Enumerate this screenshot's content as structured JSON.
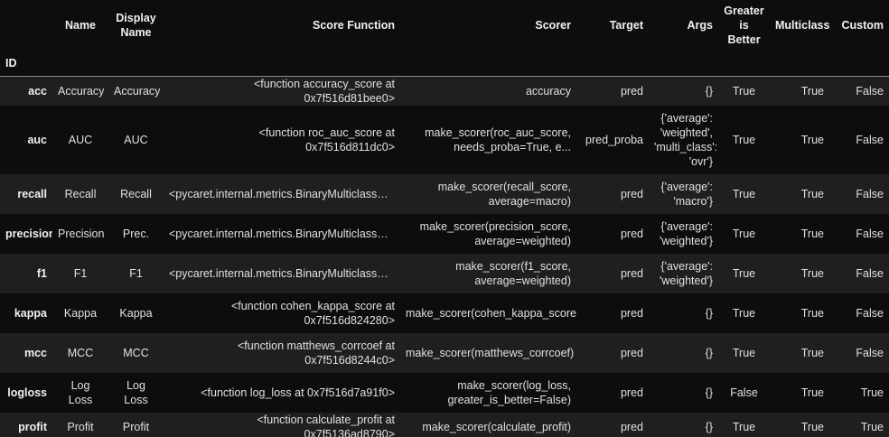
{
  "table": {
    "index_name": "ID",
    "columns": [
      "Name",
      "Display Name",
      "Score Function",
      "Scorer",
      "Target",
      "Args",
      "Greater is Better",
      "Multiclass",
      "Custom"
    ],
    "rows": [
      {
        "id": "acc",
        "cells": [
          "Accuracy",
          "Accuracy",
          "<function accuracy_score at 0x7f516d81bee0>",
          "accuracy",
          "pred",
          "{}",
          "True",
          "True",
          "False"
        ]
      },
      {
        "id": "auc",
        "cells": [
          "AUC",
          "AUC",
          "<function roc_auc_score at 0x7f516d811dc0>",
          "make_scorer(roc_auc_score, needs_proba=True, e...",
          "pred_proba",
          "{'average': 'weighted', 'multi_class': 'ovr'}",
          "True",
          "True",
          "False"
        ]
      },
      {
        "id": "recall",
        "cells": [
          "Recall",
          "Recall",
          "<pycaret.internal.metrics.BinaryMulticlassScor...",
          "make_scorer(recall_score, average=macro)",
          "pred",
          "{'average': 'macro'}",
          "True",
          "True",
          "False"
        ]
      },
      {
        "id": "precision",
        "cells": [
          "Precision",
          "Prec.",
          "<pycaret.internal.metrics.BinaryMulticlassScor...",
          "make_scorer(precision_score, average=weighted)",
          "pred",
          "{'average': 'weighted'}",
          "True",
          "True",
          "False"
        ]
      },
      {
        "id": "f1",
        "cells": [
          "F1",
          "F1",
          "<pycaret.internal.metrics.BinaryMulticlassScor...",
          "make_scorer(f1_score, average=weighted)",
          "pred",
          "{'average': 'weighted'}",
          "True",
          "True",
          "False"
        ]
      },
      {
        "id": "kappa",
        "cells": [
          "Kappa",
          "Kappa",
          "<function cohen_kappa_score at 0x7f516d824280>",
          "make_scorer(cohen_kappa_score)",
          "pred",
          "{}",
          "True",
          "True",
          "False"
        ]
      },
      {
        "id": "mcc",
        "cells": [
          "MCC",
          "MCC",
          "<function matthews_corrcoef at 0x7f516d8244c0>",
          "make_scorer(matthews_corrcoef)",
          "pred",
          "{}",
          "True",
          "True",
          "False"
        ]
      },
      {
        "id": "logloss",
        "cells": [
          "Log Loss",
          "Log Loss",
          "<function log_loss at 0x7f516d7a91f0>",
          "make_scorer(log_loss, greater_is_better=False)",
          "pred",
          "{}",
          "False",
          "True",
          "True"
        ]
      },
      {
        "id": "profit",
        "cells": [
          "Profit",
          "Profit",
          "<function calculate_profit at 0x7f5136ad8790>",
          "make_scorer(calculate_profit)",
          "pred",
          "{}",
          "True",
          "True",
          "True"
        ]
      }
    ]
  },
  "colors": {
    "background": "#0d0d0d",
    "stripe": "#1f1f1f",
    "text": "#e0e0e0",
    "header_rule": "#8a8a8a"
  }
}
